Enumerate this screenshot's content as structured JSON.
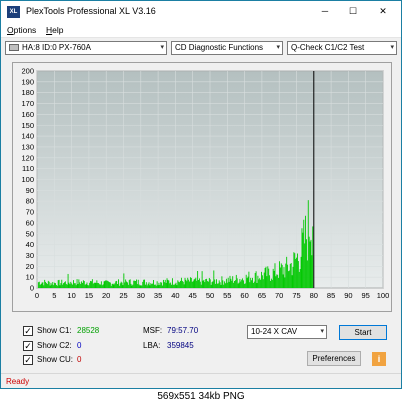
{
  "window": {
    "title": "PlexTools Professional XL V3.16",
    "app_icon_text": "XL",
    "minimize": "─",
    "maximize": "☐",
    "close": "✕"
  },
  "menu": {
    "options_u": "O",
    "options_rest": "ptions",
    "help_u": "H",
    "help_rest": "elp"
  },
  "toolbar": {
    "drive": "HA:8 ID:0  PX-760A",
    "function": "CD Diagnostic Functions",
    "test": "Q-Check C1/C2 Test",
    "arrow": "▾"
  },
  "chart_data": {
    "type": "bar",
    "title": "",
    "xlabel": "",
    "ylabel": "",
    "xlim": [
      0,
      100
    ],
    "ylim": [
      0,
      200
    ],
    "x_ticks": [
      0,
      5,
      10,
      15,
      20,
      25,
      30,
      35,
      40,
      45,
      50,
      55,
      60,
      65,
      70,
      75,
      80,
      85,
      90,
      95,
      100
    ],
    "y_ticks": [
      0,
      10,
      20,
      30,
      40,
      50,
      60,
      70,
      80,
      90,
      100,
      110,
      120,
      130,
      140,
      150,
      160,
      170,
      180,
      190,
      200
    ],
    "grid": true,
    "marker_x": 80,
    "series": [
      {
        "color": "#00c800",
        "x": [
          1,
          5,
          10,
          15,
          20,
          25,
          30,
          35,
          40,
          45,
          50,
          55,
          60,
          62,
          64,
          66,
          68,
          70,
          72,
          74,
          75,
          76,
          77,
          78,
          79,
          79.8
        ],
        "values": [
          6,
          5,
          6,
          6,
          5,
          6,
          6,
          6,
          7,
          7,
          7,
          8,
          10,
          12,
          12,
          14,
          15,
          18,
          20,
          25,
          30,
          34,
          45,
          55,
          70,
          78
        ]
      }
    ]
  },
  "controls": {
    "show_c1_label": "Show C1:",
    "show_c1_value": "28528",
    "show_c2_label": "Show C2:",
    "show_c2_value": "0",
    "show_cu_label": "Show CU:",
    "show_cu_value": "0",
    "check": "✓",
    "msf_label": "MSF:",
    "msf_value": "79:57.70",
    "lba_label": "LBA:",
    "lba_value": "359845",
    "speed": "10-24 X CAV",
    "start": "Start",
    "preferences": "Preferences",
    "info": "i",
    "colors": {
      "c1": "#00a000",
      "c2": "#0000c0",
      "cu": "#c00000"
    }
  },
  "status": {
    "text": "Ready",
    "color": "#cc0000"
  },
  "caption": "569x551  34kb  PNG"
}
